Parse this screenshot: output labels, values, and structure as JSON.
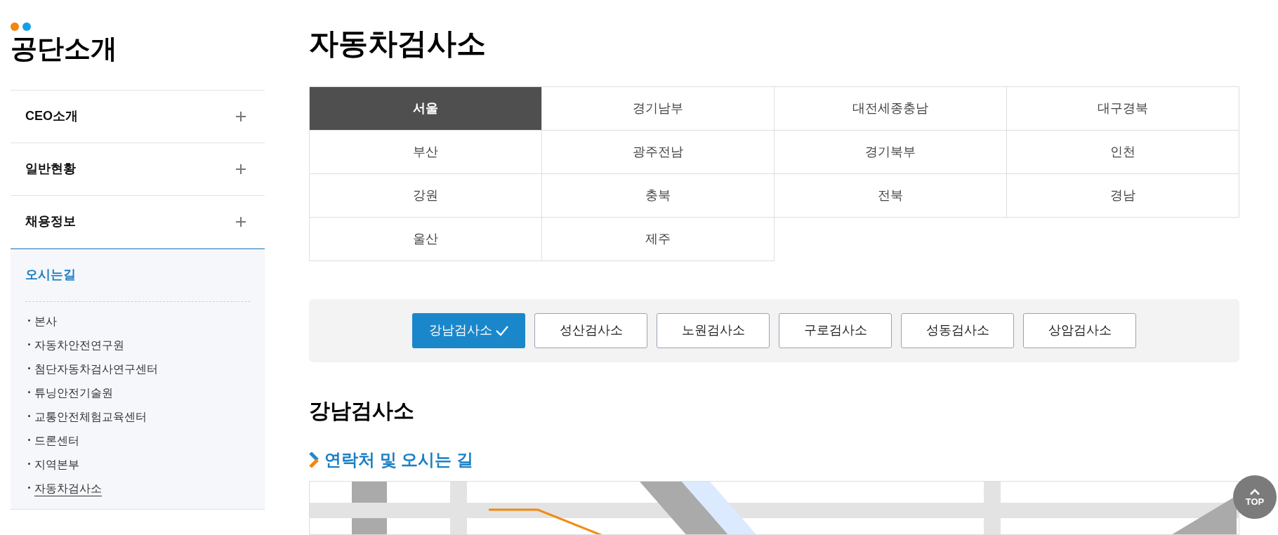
{
  "sidebar": {
    "title": "공단소개",
    "items": [
      {
        "label": "CEO소개",
        "expanded": false
      },
      {
        "label": "일반현황",
        "expanded": false
      },
      {
        "label": "채용정보",
        "expanded": false
      },
      {
        "label": "오시는길",
        "expanded": true,
        "children": [
          {
            "label": "본사",
            "selected": false
          },
          {
            "label": "자동차안전연구원",
            "selected": false
          },
          {
            "label": "첨단자동차검사연구센터",
            "selected": false
          },
          {
            "label": "튜닝안전기술원",
            "selected": false
          },
          {
            "label": "교통안전체험교육센터",
            "selected": false
          },
          {
            "label": "드론센터",
            "selected": false
          },
          {
            "label": "지역본부",
            "selected": false
          },
          {
            "label": "자동차검사소",
            "selected": true
          }
        ]
      }
    ]
  },
  "page_title": "자동차검사소",
  "regions": [
    {
      "label": "서울",
      "selected": true
    },
    {
      "label": "경기남부",
      "selected": false
    },
    {
      "label": "대전세종충남",
      "selected": false
    },
    {
      "label": "대구경북",
      "selected": false
    },
    {
      "label": "부산",
      "selected": false
    },
    {
      "label": "광주전남",
      "selected": false
    },
    {
      "label": "경기북부",
      "selected": false
    },
    {
      "label": "인천",
      "selected": false
    },
    {
      "label": "강원",
      "selected": false
    },
    {
      "label": "충북",
      "selected": false
    },
    {
      "label": "전북",
      "selected": false
    },
    {
      "label": "경남",
      "selected": false
    },
    {
      "label": "울산",
      "selected": false
    },
    {
      "label": "제주",
      "selected": false
    }
  ],
  "stations": [
    {
      "label": "강남검사소",
      "selected": true
    },
    {
      "label": "성산검사소",
      "selected": false
    },
    {
      "label": "노원검사소",
      "selected": false
    },
    {
      "label": "구로검사소",
      "selected": false
    },
    {
      "label": "성동검사소",
      "selected": false
    },
    {
      "label": "상암검사소",
      "selected": false
    }
  ],
  "station_title": "강남검사소",
  "section_title": "연락처 및 오시는 길",
  "top_button": "TOP"
}
